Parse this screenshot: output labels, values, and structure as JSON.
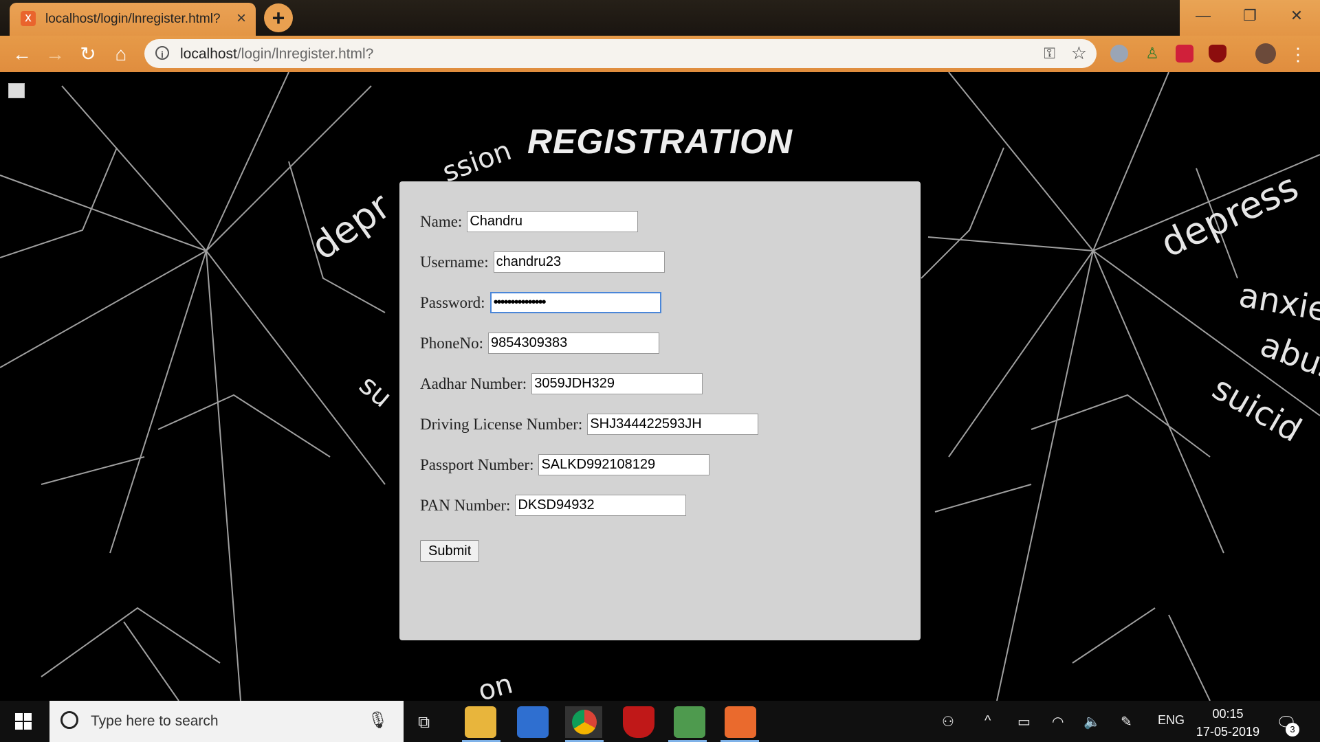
{
  "browser": {
    "tab_title": "localhost/login/lnregister.html?",
    "new_tab": "+",
    "url_host": "localhost",
    "url_path": "/login/lnregister.html?",
    "window_controls": [
      "—",
      "❐",
      "✕"
    ]
  },
  "page": {
    "title": "REGISTRATION",
    "fields": [
      {
        "label": "Name:",
        "value": "Chandru"
      },
      {
        "label": "Username:",
        "value": "chandru23"
      },
      {
        "label": "Password:",
        "value": "•••••••••••••••"
      },
      {
        "label": "PhoneNo:",
        "value": "9854309383"
      },
      {
        "label": "Aadhar Number:",
        "value": "3059JDH329"
      },
      {
        "label": "Driving License Number:",
        "value": "SHJ344422593JH"
      },
      {
        "label": "Passport Number:",
        "value": "SALKD992108129"
      },
      {
        "label": "PAN Number:",
        "value": "DKSD94932"
      }
    ],
    "submit_label": "Submit"
  },
  "taskbar": {
    "search_placeholder": "Type here to search",
    "language": "ENG",
    "time": "00:15",
    "date": "17-05-2019",
    "notification_count": "3"
  },
  "colors": {
    "chrome_orange": "#e39545",
    "panel_gray": "#d3d3d3",
    "focus_blue": "#4a86d8"
  }
}
